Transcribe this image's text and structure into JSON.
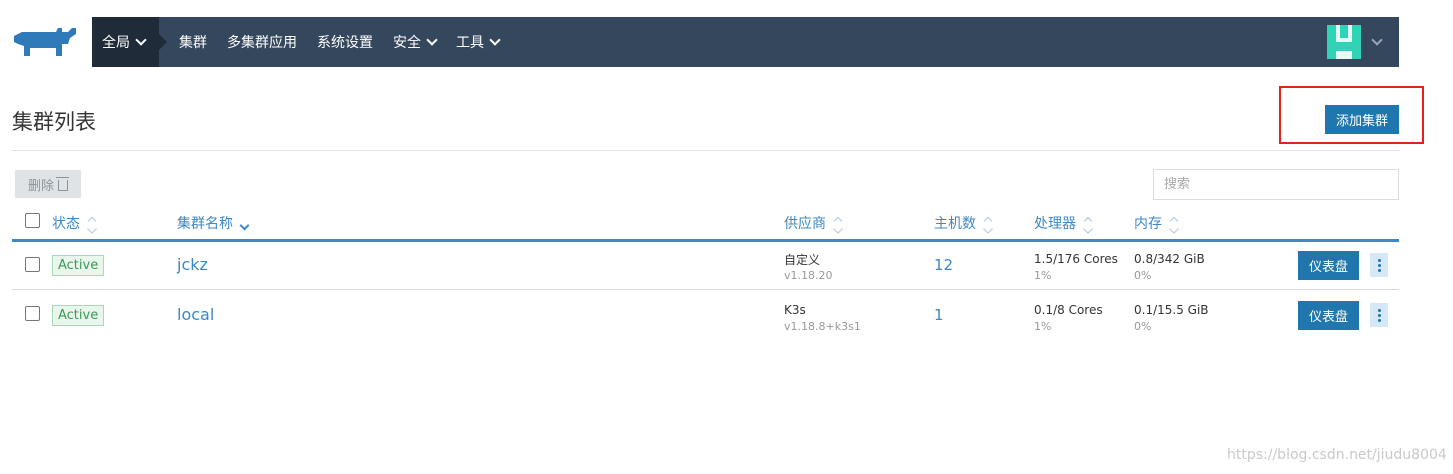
{
  "nav": {
    "global": "全局",
    "items": [
      "集群",
      "多集群应用",
      "系统设置",
      "安全",
      "工具"
    ]
  },
  "page": {
    "title": "集群列表",
    "add_button": "添加集群",
    "delete_button": "删除",
    "search_placeholder": "搜索"
  },
  "table": {
    "headers": {
      "state": "状态",
      "name": "集群名称",
      "provider": "供应商",
      "hosts": "主机数",
      "cpu": "处理器",
      "memory": "内存"
    },
    "rows": [
      {
        "state": "Active",
        "name": "jckz",
        "provider": "自定义",
        "version": "v1.18.20",
        "hosts": "12",
        "cpu": "1.5/176 Cores",
        "cpu_pct": "1%",
        "memory": "0.8/342 GiB",
        "memory_pct": "0%",
        "action": "仪表盘"
      },
      {
        "state": "Active",
        "name": "local",
        "provider": "K3s",
        "version": "v1.18.8+k3s1",
        "hosts": "1",
        "cpu": "0.1/8 Cores",
        "cpu_pct": "1%",
        "memory": "0.1/15.5 GiB",
        "memory_pct": "0%",
        "action": "仪表盘"
      }
    ]
  },
  "watermark": "https://blog.csdn.net/jiudu8004",
  "colors": {
    "nav_bg": "#34475d",
    "nav_active": "#1f2b38",
    "primary": "#1f77ad",
    "link": "#3d88c6",
    "highlight": "#e3221c",
    "active_badge": "#3a9b55"
  },
  "icons": [
    "rancher-logo-icon",
    "chevron-down-icon",
    "trash-icon",
    "sort-icon",
    "more-vertical-icon",
    "user-avatar-icon"
  ]
}
